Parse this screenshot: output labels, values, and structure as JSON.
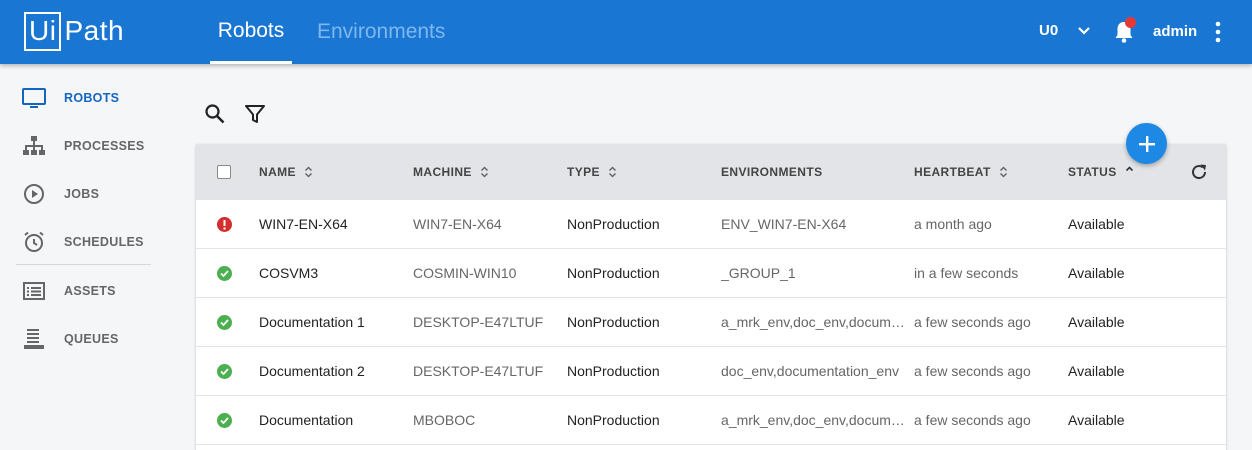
{
  "header": {
    "logo_boxed": "Ui",
    "logo_rest": "Path",
    "tabs": [
      {
        "label": "Robots"
      },
      {
        "label": "Environments"
      }
    ],
    "org_unit": "U0",
    "user": "admin"
  },
  "sidebar": {
    "items": [
      {
        "label": "ROBOTS",
        "icon": "monitor-icon"
      },
      {
        "label": "PROCESSES",
        "icon": "hierarchy-icon"
      },
      {
        "label": "JOBS",
        "icon": "play-circle-icon"
      },
      {
        "label": "SCHEDULES",
        "icon": "alarm-clock-icon"
      },
      {
        "label": "ASSETS",
        "icon": "list-icon"
      },
      {
        "label": "QUEUES",
        "icon": "stack-icon"
      }
    ]
  },
  "table": {
    "columns": [
      "NAME",
      "MACHINE",
      "TYPE",
      "ENVIRONMENTS",
      "HEARTBEAT",
      "STATUS"
    ],
    "rows": [
      {
        "state": "error",
        "name": "WIN7-EN-X64",
        "machine": "WIN7-EN-X64",
        "type": "NonProduction",
        "environments": "ENV_WIN7-EN-X64",
        "heartbeat": "a month ago",
        "status": "Available"
      },
      {
        "state": "ok",
        "name": "COSVM3",
        "machine": "COSMIN-WIN10",
        "type": "NonProduction",
        "environments": "_GROUP_1",
        "heartbeat": "in a few seconds",
        "status": "Available"
      },
      {
        "state": "ok",
        "name": "Documentation 1",
        "machine": "DESKTOP-E47LTUF",
        "type": "NonProduction",
        "environments": "a_mrk_env,doc_env,documentation_env",
        "heartbeat": "a few seconds ago",
        "status": "Available"
      },
      {
        "state": "ok",
        "name": "Documentation 2",
        "machine": "DESKTOP-E47LTUF",
        "type": "NonProduction",
        "environments": "doc_env,documentation_env",
        "heartbeat": "a few seconds ago",
        "status": "Available"
      },
      {
        "state": "ok",
        "name": "Documentation",
        "machine": "MBOBOC",
        "type": "NonProduction",
        "environments": "a_mrk_env,doc_env,documentation_env",
        "heartbeat": "a few seconds ago",
        "status": "Available"
      }
    ]
  },
  "colors": {
    "header_bg": "#1976d2",
    "accent": "#1e88e5",
    "ok": "#4caf50",
    "error": "#d32f2f"
  }
}
